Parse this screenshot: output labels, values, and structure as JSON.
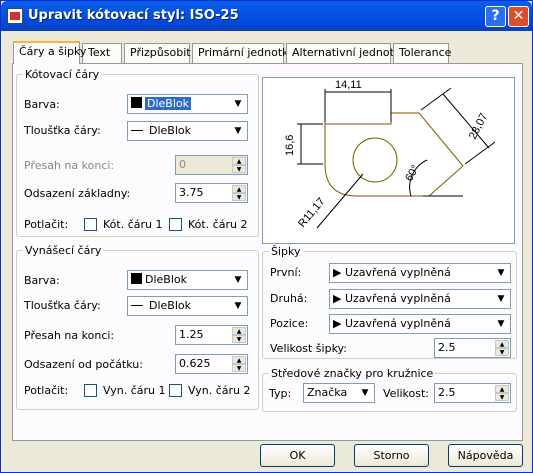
{
  "title": "Upravit kótovací styl: ISO-25",
  "titlebar": {
    "help": "?",
    "close": "✕"
  },
  "tabs": [
    "Čáry a šipky",
    "Text",
    "Přizpůsobit",
    "Primární jednotky",
    "Alternativní jednotky",
    "Tolerance"
  ],
  "dim_lines": {
    "legend": "Kótovací čáry",
    "color_label": "Barva:",
    "color_value": "DleBlok",
    "lineweight_label": "Tloušťka čáry:",
    "lineweight_value": "DleBlok",
    "extend_label": "Přesah na konci:",
    "extend_value": "0",
    "baseline_label": "Odsazení základny:",
    "baseline_value": "3.75",
    "suppress_label": "Potlačit:",
    "suppress_1": "Kót. čáru 1",
    "suppress_2": "Kót. čáru 2"
  },
  "ext_lines": {
    "legend": "Vynášecí čáry",
    "color_label": "Barva:",
    "color_value": "DleBlok",
    "lineweight_label": "Tloušťka čáry:",
    "lineweight_value": "DleBlok",
    "extend_label": "Přesah na konci:",
    "extend_value": "1.25",
    "offset_label": "Odsazení od počátku:",
    "offset_value": "0.625",
    "suppress_label": "Potlačit:",
    "suppress_1": "Vyn. čáru 1",
    "suppress_2": "Vyn. čáru 2"
  },
  "preview": {
    "d1": "14,11",
    "d2": "16,6",
    "d3": "28,07",
    "d4": "60°",
    "d5": "R11,17"
  },
  "arrows": {
    "legend": "Šipky",
    "first_label": "První:",
    "first_value": "Uzavřená vyplněná",
    "second_label": "Druhá:",
    "second_value": "Uzavřená vyplněná",
    "leader_label": "Pozice:",
    "leader_value": "Uzavřená vyplněná",
    "size_label": "Velikost šipky:",
    "size_value": "2.5"
  },
  "center": {
    "legend": "Středové značky pro kružnice",
    "type_label": "Typ:",
    "type_value": "Značka",
    "size_label": "Velikost:",
    "size_value": "2.5"
  },
  "buttons": {
    "ok": "OK",
    "cancel": "Storno",
    "help": "Nápověda"
  }
}
